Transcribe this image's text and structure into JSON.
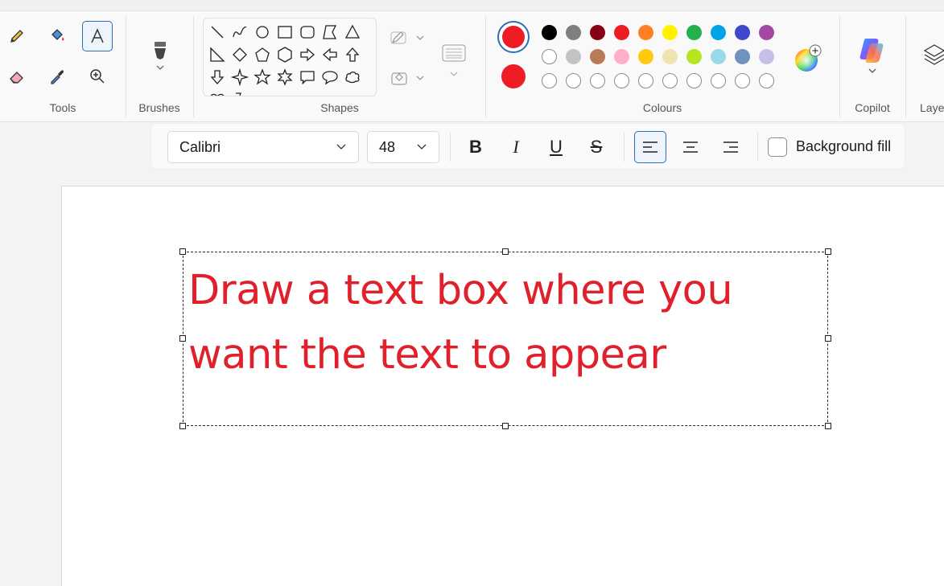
{
  "ribbon": {
    "groups": {
      "tools": "Tools",
      "brushes": "Brushes",
      "shapes": "Shapes",
      "colours": "Colours",
      "copilot": "Copilot",
      "layers": "Laye"
    }
  },
  "colours": {
    "colour1": "#ee1c24",
    "colour2": "#ee1c24",
    "palette_row1": [
      "#000000",
      "#7f7f7f",
      "#880015",
      "#ed1c24",
      "#ff7f27",
      "#fff200",
      "#22b14c",
      "#00a2e8",
      "#3f48cc",
      "#a349a4"
    ],
    "palette_row2": [
      "#ffffff",
      "#c3c3c3",
      "#b97a57",
      "#ffaec9",
      "#ffc90e",
      "#efe4b0",
      "#b5e61d",
      "#99d9ea",
      "#7092be",
      "#c8bfe7"
    ],
    "palette_row3_empty_count": 10
  },
  "text_toolbar": {
    "font_family": "Calibri",
    "font_size": "48",
    "bold": "B",
    "italic": "I",
    "underline": "U",
    "strikethrough": "S",
    "background_fill_label": "Background fill",
    "alignment": "left"
  },
  "canvas": {
    "text_line1": "Draw a text box where you",
    "text_line2": "want the text to appear",
    "text_colour": "#e0202a"
  }
}
